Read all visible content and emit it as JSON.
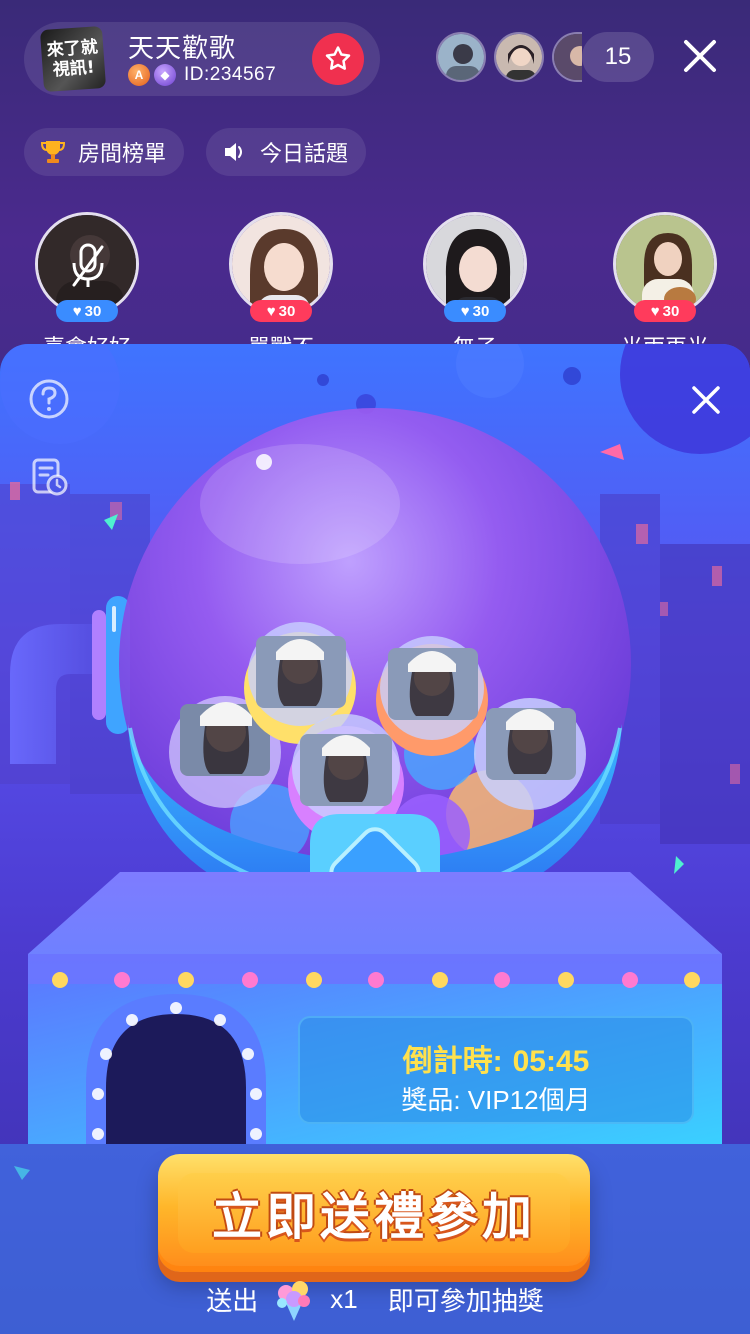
{
  "room": {
    "logo_text_line1": "來了就",
    "logo_text_line2": "視訊!",
    "title": "天天歡歌",
    "id_label": "ID:234567"
  },
  "viewers": {
    "count": "15"
  },
  "pills": [
    {
      "icon": "trophy-icon",
      "label": "房間榜單"
    },
    {
      "icon": "speaker-icon",
      "label": "今日話題"
    }
  ],
  "seats": [
    {
      "name": "喜會好好",
      "hearts": "30",
      "heart_badge": "blue",
      "muted": true
    },
    {
      "name": "單戰不",
      "hearts": "30",
      "heart_badge": "red",
      "muted": false
    },
    {
      "name": "無子",
      "hearts": "30",
      "heart_badge": "blue",
      "muted": false
    },
    {
      "name": "光雨再光",
      "hearts": "30",
      "heart_badge": "red",
      "muted": false
    }
  ],
  "lottery": {
    "countdown_label": "倒計時:",
    "countdown_time": "05:45",
    "prize_label": "獎品: VIP12個月",
    "cta_label": "立即送禮參加",
    "footer_prefix": "送出",
    "footer_qty": "x1",
    "footer_suffix": "即可參加抽獎",
    "gift_icon": "bouquet-icon"
  },
  "colors": {
    "accent_red": "#f0304f",
    "countdown_yellow": "#ffe14d",
    "cta_orange": "#ffb62a"
  }
}
